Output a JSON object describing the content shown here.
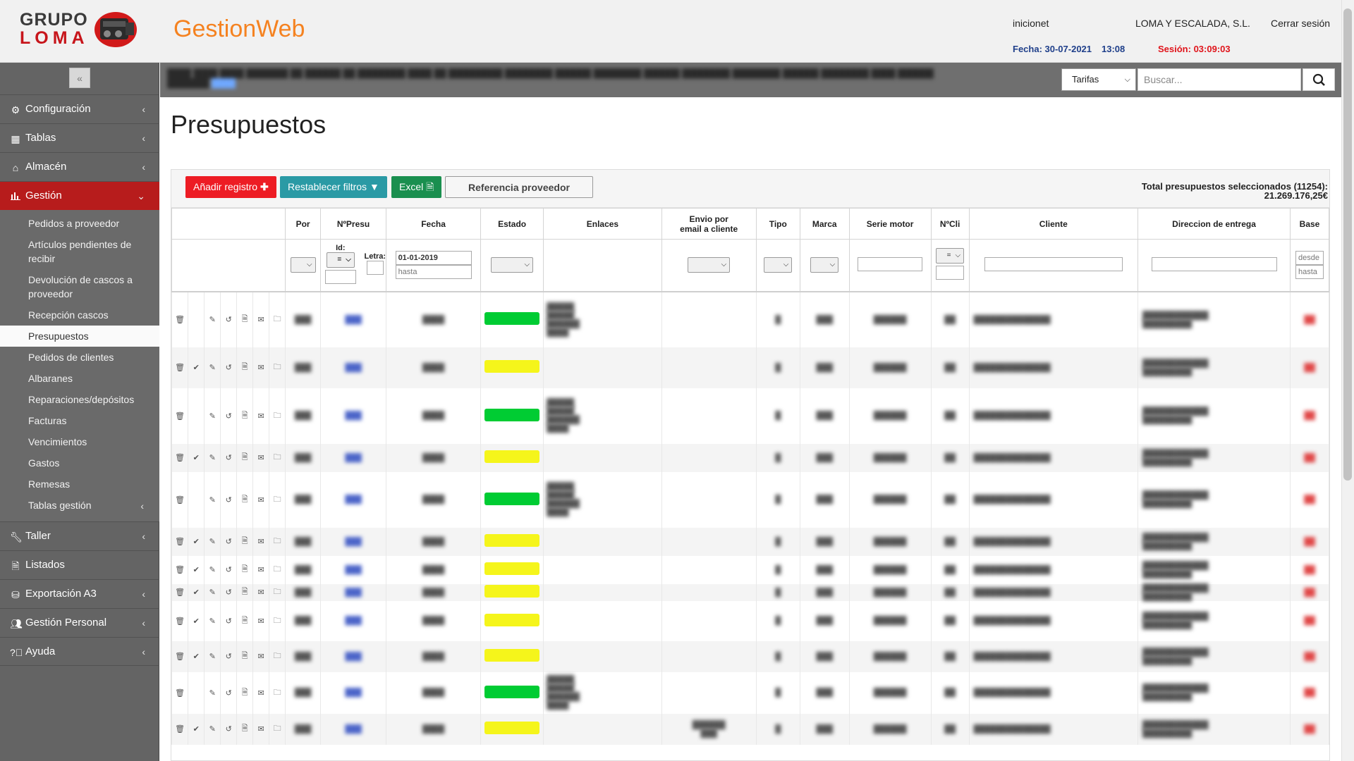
{
  "header": {
    "logo_line1": "GRUPO",
    "logo_line2": "LOMA",
    "app_title": "GestionWeb",
    "user": "inicionet",
    "company": "LOMA Y ESCALADA, S.L.",
    "logout": "Cerrar sesión",
    "date": "Fecha: 30-07-2021",
    "time": "13:08",
    "session": "Sesión: 03:09:03"
  },
  "sidebar": {
    "collapse": "«",
    "items": [
      {
        "label": "Configuración",
        "icon": "gear-icon"
      },
      {
        "label": "Tablas",
        "icon": "table-icon"
      },
      {
        "label": "Almacén",
        "icon": "home-icon"
      },
      {
        "label": "Gestión",
        "icon": "bar-chart-icon"
      },
      {
        "label": "Taller",
        "icon": "wrench-icon"
      },
      {
        "label": "Listados",
        "icon": "document-icon"
      },
      {
        "label": "Exportación A3",
        "icon": "database-icon"
      },
      {
        "label": "Gestión Personal",
        "icon": "users-icon"
      },
      {
        "label": "Ayuda",
        "icon": "help-icon"
      }
    ],
    "gestion_sub": [
      "Pedidos a proveedor",
      "Artículos pendientes de recibir",
      "Devolución de cascos a proveedor",
      "Recepción cascos",
      "Presupuestos",
      "Pedidos de clientes",
      "Albaranes",
      "Reparaciones/depósitos",
      "Facturas",
      "Vencimientos",
      "Gastos",
      "Remesas",
      "Tablas gestión"
    ]
  },
  "topbar": {
    "select_value": "Tarifas",
    "search_placeholder": "Buscar..."
  },
  "page": {
    "title": "Presupuestos"
  },
  "toolbar": {
    "add": "Añadir registro",
    "reset": "Restablecer filtros",
    "excel": "Excel",
    "ref": "Referencia proveedor",
    "total_line1": "Total presupuestos seleccionados (11254):",
    "total_line2": "21.269.176,25€"
  },
  "table": {
    "headers": {
      "por": "Por",
      "npresu": "NºPresu",
      "fecha": "Fecha",
      "estado": "Estado",
      "enlaces": "Enlaces",
      "envio_l1": "Envio por",
      "envio_l2": "email a cliente",
      "tipo": "Tipo",
      "marca": "Marca",
      "serie": "Serie motor",
      "ncli": "NºCli",
      "cliente": "Cliente",
      "direccion": "Direccion de entrega",
      "base": "Base"
    },
    "filters": {
      "id_label": "Id:",
      "id_op": "=",
      "letra_label": "Letra:",
      "fecha_desde": "01-01-2019",
      "fecha_hasta": "hasta",
      "ncli_op": "=",
      "base_desde": "desde",
      "base_hasta": "hasta"
    },
    "rows": [
      {
        "check": false,
        "estado": "green",
        "enlaces": true,
        "envio": false
      },
      {
        "check": true,
        "estado": "yellow",
        "enlaces": false,
        "envio": false
      },
      {
        "check": false,
        "estado": "green",
        "enlaces": true,
        "envio": false
      },
      {
        "check": true,
        "estado": "yellow",
        "enlaces": false,
        "envio": false
      },
      {
        "check": false,
        "estado": "green",
        "enlaces": true,
        "envio": false
      },
      {
        "check": true,
        "estado": "yellow",
        "enlaces": false,
        "envio": false
      },
      {
        "check": true,
        "estado": "yellow",
        "enlaces": false,
        "envio": false
      },
      {
        "check": true,
        "estado": "yellow",
        "enlaces": false,
        "envio": false
      },
      {
        "check": true,
        "estado": "yellow",
        "enlaces": false,
        "envio": false
      },
      {
        "check": true,
        "estado": "yellow",
        "enlaces": false,
        "envio": false
      },
      {
        "check": false,
        "estado": "green",
        "enlaces": true,
        "envio": false
      },
      {
        "check": true,
        "estado": "yellow",
        "enlaces": false,
        "envio": true
      }
    ]
  },
  "colors": {
    "accent_orange": "#f58220",
    "active_red": "#b71c1c",
    "add_red": "#ed1c24",
    "reset_teal": "#2a9aa5",
    "excel_green": "#1a8f4f",
    "estado_green": "#00cc33",
    "estado_yellow": "#f5f51b"
  }
}
